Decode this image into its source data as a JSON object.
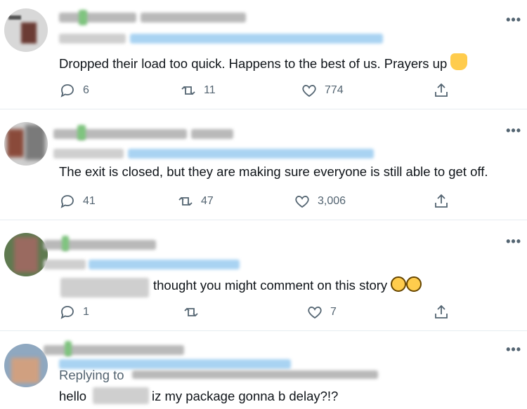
{
  "tweets": [
    {
      "text": "Dropped their load too quick. Happens to the best of us. Prayers up",
      "emoji": "folded-hands",
      "replies": "6",
      "retweets": "11",
      "likes": "774"
    },
    {
      "text": "The exit is closed, but they are making sure everyone is still able to get off.",
      "replies": "41",
      "retweets": "47",
      "likes": "3,006"
    },
    {
      "text": "thought you might comment on this story",
      "emoji": "rolling-on-floor-laughing",
      "replies": "1",
      "retweets": "",
      "likes": "7"
    },
    {
      "replying_label": "Replying to",
      "text_before": "hello",
      "text_after": "iz my package gonna b delay?!?"
    }
  ],
  "more_glyph": "•••",
  "colors": {
    "icon": "#536471",
    "divider": "#e6ecf0",
    "mention_blur": "#a9d3f2"
  },
  "icons": [
    "reply-icon",
    "retweet-icon",
    "like-icon",
    "share-icon",
    "more-icon"
  ]
}
